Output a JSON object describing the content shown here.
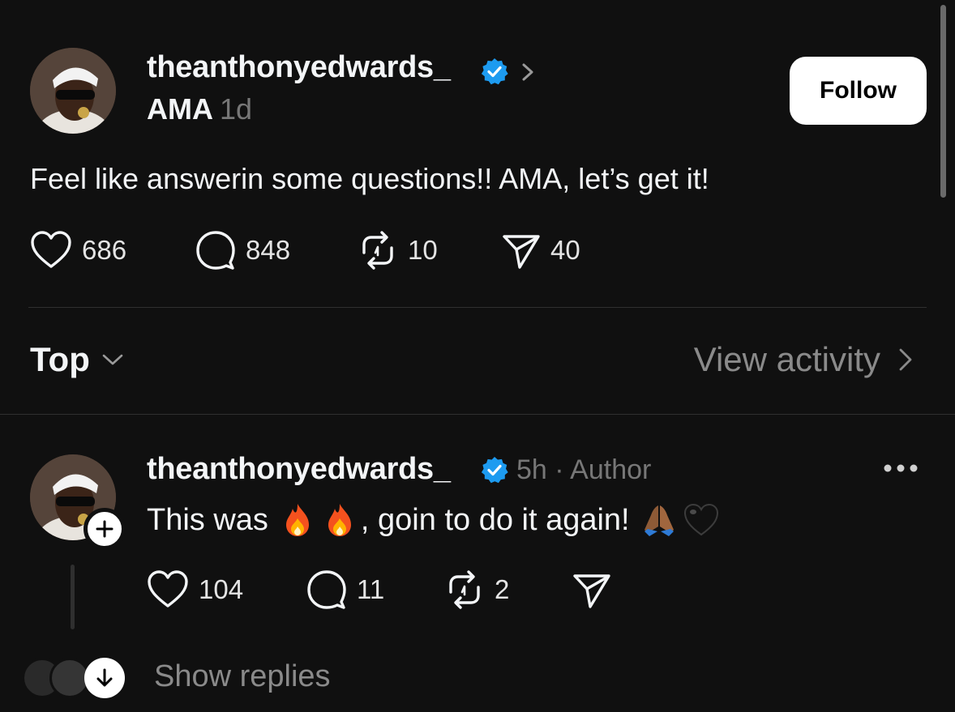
{
  "post": {
    "username": "theanthonyedwards_",
    "title": "AMA",
    "time": "1d",
    "follow_label": "Follow",
    "body": "Feel like answerin some questions!! AMA, let’s get it!",
    "likes": "686",
    "comments": "848",
    "reposts": "10",
    "shares": "40"
  },
  "sort": {
    "label": "Top",
    "view_activity": "View activity"
  },
  "reply": {
    "username": "theanthonyedwards_",
    "meta": "5h · Author",
    "body_start": "This was",
    "body_middle": ", goin to do it again!",
    "emojis": [
      "fire",
      "fire",
      "folded-hands-medium-dark",
      "black-heart"
    ],
    "likes": "104",
    "comments": "11",
    "reposts": "2",
    "show_replies": "Show replies"
  },
  "colors": {
    "background": "#101010",
    "verified": "#1d9bf0",
    "muted": "#777777"
  }
}
